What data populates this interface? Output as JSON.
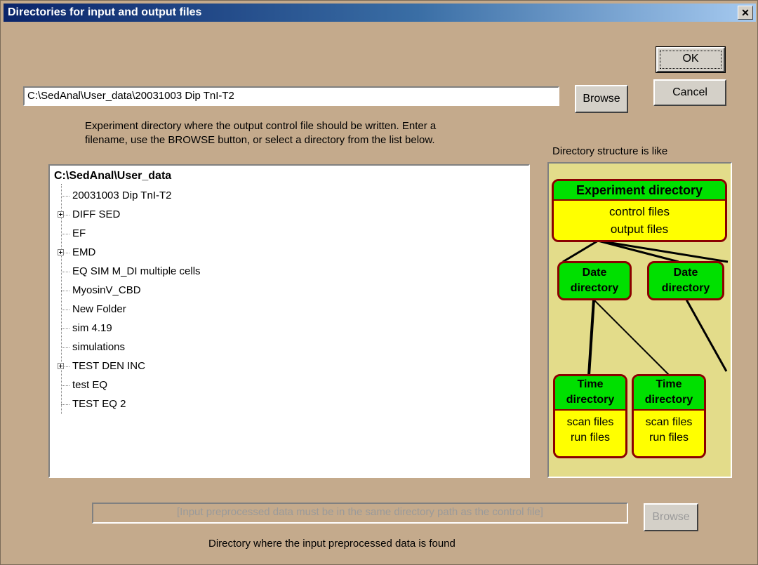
{
  "window": {
    "title": "Directories for input and output files",
    "close_label": "✕"
  },
  "buttons": {
    "ok": "OK",
    "cancel": "Cancel",
    "browse_output": "Browse",
    "browse_input": "Browse"
  },
  "output_path": {
    "value": "C:\\SedAnal\\User_data\\20031003 Dip TnI-T2"
  },
  "instructions": {
    "line1": "Experiment directory where the output control file should be written. Enter a",
    "line2": "filename, use the BROWSE button, or select a directory from the list below."
  },
  "tree": {
    "root": "C:\\SedAnal\\User_data",
    "items": [
      {
        "label": "20031003 Dip TnI-T2",
        "expandable": false
      },
      {
        "label": "DIFF SED",
        "expandable": true
      },
      {
        "label": "EF",
        "expandable": false
      },
      {
        "label": "EMD",
        "expandable": true
      },
      {
        "label": "EQ SIM M_DI multiple cells",
        "expandable": false
      },
      {
        "label": "MyosinV_CBD",
        "expandable": false
      },
      {
        "label": "New Folder",
        "expandable": false
      },
      {
        "label": "sim 4.19",
        "expandable": false
      },
      {
        "label": "simulations",
        "expandable": false
      },
      {
        "label": "TEST DEN INC",
        "expandable": true
      },
      {
        "label": "test EQ",
        "expandable": false
      },
      {
        "label": "TEST EQ 2",
        "expandable": false
      }
    ]
  },
  "diagram": {
    "caption": "Directory structure is like",
    "experiment": {
      "title": "Experiment directory",
      "line1": "control files",
      "line2": "output files"
    },
    "date1": {
      "line1": "Date",
      "line2": "directory"
    },
    "date2": {
      "line1": "Date",
      "line2": "directory"
    },
    "time1": {
      "line1": "Time",
      "line2": "directory",
      "body1": "scan files",
      "body2": "run files"
    },
    "time2": {
      "line1": "Time",
      "line2": "directory",
      "body1": "scan files",
      "body2": "run files"
    },
    "colors": {
      "background": "#e3dc8a",
      "header": "#00e000",
      "body": "#ffff00",
      "border": "#8b0000"
    }
  },
  "input_path": {
    "placeholder": "[Input preprocessed data must be in the same directory path as the control file]",
    "caption": "Directory where the input preprocessed data is found"
  }
}
